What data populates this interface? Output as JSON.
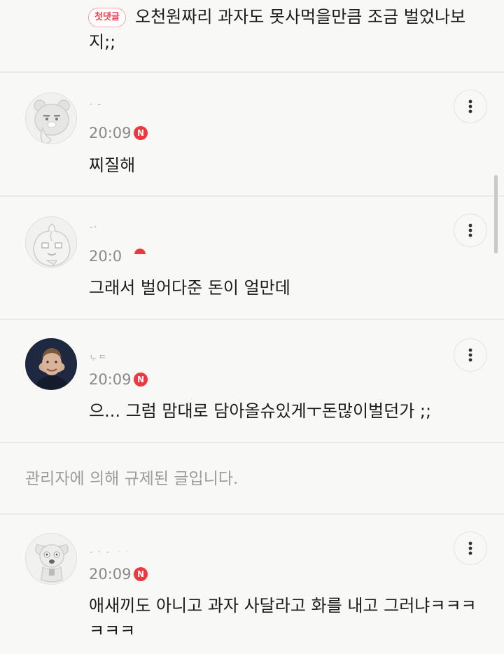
{
  "first_comment": {
    "badge": "첫댓글",
    "text": "오천원짜리 과자도 못사먹을만큼 조금 벌었나보지;;"
  },
  "comments": [
    {
      "nickname": "· -",
      "time": "20:09",
      "badge": "N",
      "text": "찌질해",
      "avatar_icon": "ryan-character-avatar"
    },
    {
      "nickname": "-·",
      "time": "20:0",
      "badge": "",
      "text": "그래서 벌어다준 돈이 얼만데",
      "avatar_icon": "apeach-character-avatar"
    },
    {
      "nickname": "ᄂᆞᄃ",
      "time": "20:09",
      "badge": "N",
      "text": "으... 그럼 맘대로 담아올슈있게ㅜ돈많이벌던가 ;;",
      "avatar_icon": "profile-photo-avatar"
    },
    {
      "nickname": "-  ·  - ᆞᆞ",
      "time": "20:09",
      "badge": "N",
      "text": "애새끼도 아니고 과자 사달라고 화를 내고 그러냐ㅋㅋㅋㅋㅋㅋ",
      "avatar_icon": "frodo-character-avatar"
    }
  ],
  "blocked_notice": "관리자에 의해 규제된 글입니다.",
  "colors": {
    "accent_red": "#f0363e",
    "background": "#f8f9f7",
    "divider": "#ebebeb"
  }
}
